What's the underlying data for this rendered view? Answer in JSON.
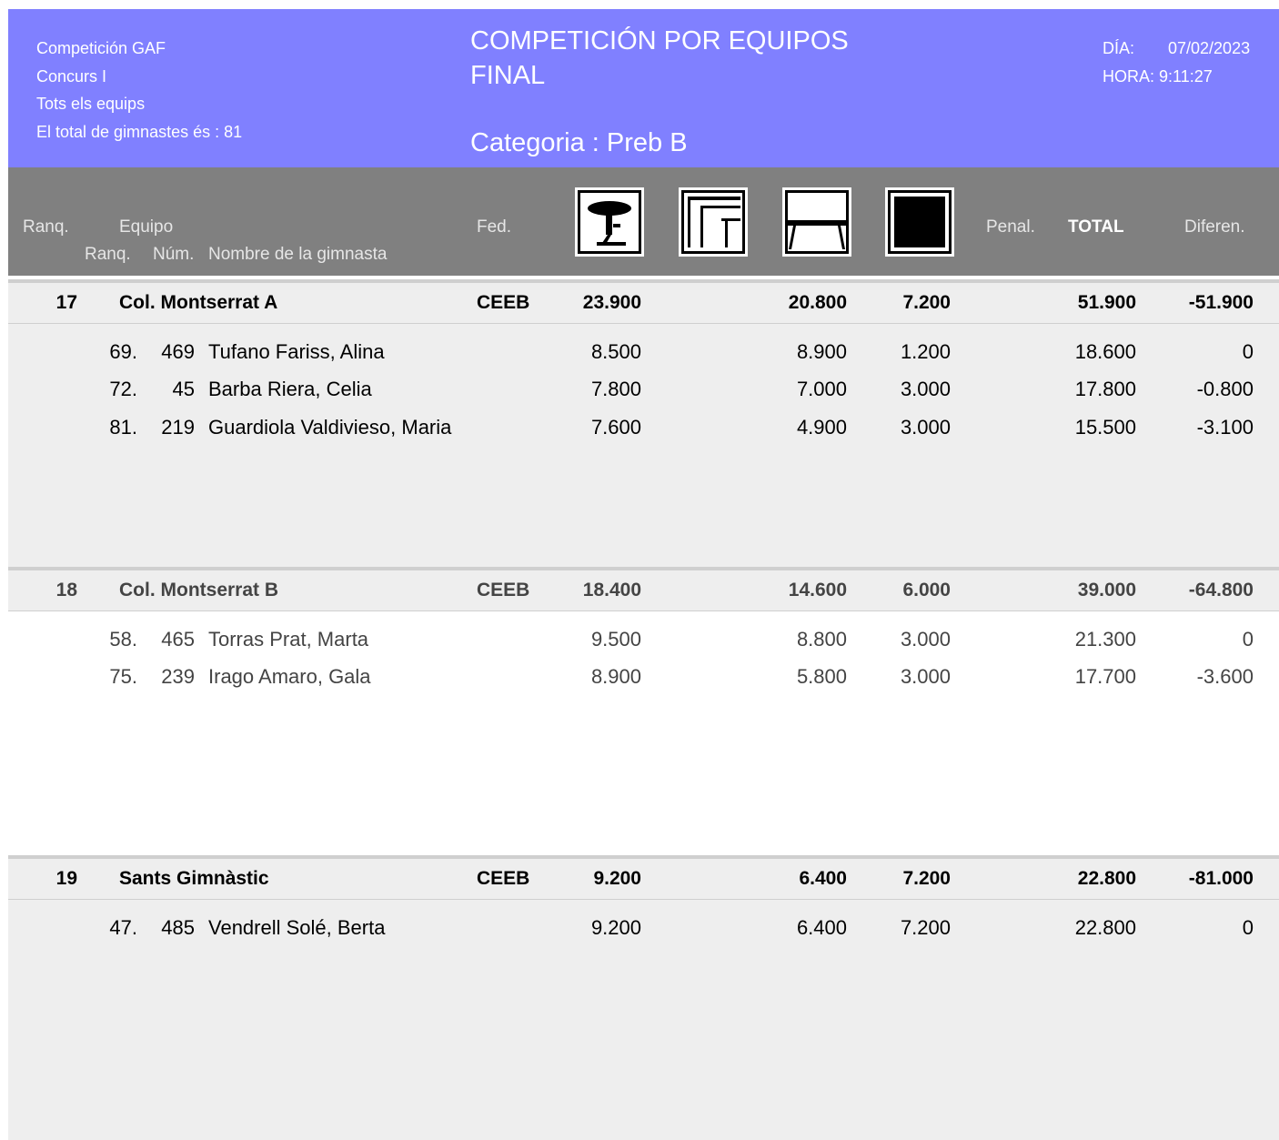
{
  "header": {
    "info_lines": [
      "Competición GAF",
      "Concurs I",
      "Tots els equips",
      "El total de gimnastes és : 81"
    ],
    "title_lines": [
      "COMPETICIÓN POR EQUIPOS",
      "FINAL"
    ],
    "category": "Categoria : Preb B",
    "date_label": "DÍA:",
    "date_value": "07/02/2023",
    "time_label": "HORA:",
    "time_value": "9:11:27"
  },
  "columns": {
    "rank": "Ranq.",
    "team": "Equipo",
    "sub_rank": "Ranq.",
    "num": "Núm.",
    "name": "Nombre de la gimnasta",
    "fed": "Fed.",
    "apparatus_icons": [
      "vault-icon",
      "uneven-bars-icon",
      "beam-icon",
      "floor-icon"
    ],
    "penal": "Penal.",
    "total": "TOTAL",
    "diff": "Diferen."
  },
  "colors": {
    "header_bg": "#8080ff",
    "column_header_bg": "#808080",
    "row_bg": "#eeeeee"
  },
  "teams": [
    {
      "rank": "17",
      "name": "Col. Montserrat A",
      "fed": "CEEB",
      "vault": "23.900",
      "bars": "",
      "beam": "20.800",
      "floor": "7.200",
      "penal": "",
      "total": "51.900",
      "diff": "-51.900",
      "gymnasts": [
        {
          "rank": "69.",
          "num": "469",
          "name": "Tufano Fariss, Alina",
          "vault": "8.500",
          "beam": "8.900",
          "floor": "1.200",
          "total": "18.600",
          "diff": "0"
        },
        {
          "rank": "72.",
          "num": "45",
          "name": "Barba Riera, Celia",
          "vault": "7.800",
          "beam": "7.000",
          "floor": "3.000",
          "total": "17.800",
          "diff": "-0.800"
        },
        {
          "rank": "81.",
          "num": "219",
          "name": "Guardiola Valdivieso, Maria",
          "vault": "7.600",
          "beam": "4.900",
          "floor": "3.000",
          "total": "15.500",
          "diff": "-3.100"
        }
      ]
    },
    {
      "rank": "18",
      "name": "Col. Montserrat B",
      "fed": "CEEB",
      "vault": "18.400",
      "bars": "",
      "beam": "14.600",
      "floor": "6.000",
      "penal": "",
      "total": "39.000",
      "diff": "-64.800",
      "gymnasts": [
        {
          "rank": "58.",
          "num": "465",
          "name": "Torras Prat, Marta",
          "vault": "9.500",
          "beam": "8.800",
          "floor": "3.000",
          "total": "21.300",
          "diff": "0"
        },
        {
          "rank": "75.",
          "num": "239",
          "name": "Irago Amaro, Gala",
          "vault": "8.900",
          "beam": "5.800",
          "floor": "3.000",
          "total": "17.700",
          "diff": "-3.600"
        }
      ]
    },
    {
      "rank": "19",
      "name": "Sants Gimnàstic",
      "fed": "CEEB",
      "vault": "9.200",
      "bars": "",
      "beam": "6.400",
      "floor": "7.200",
      "penal": "",
      "total": "22.800",
      "diff": "-81.000",
      "gymnasts": [
        {
          "rank": "47.",
          "num": "485",
          "name": "Vendrell Solé, Berta",
          "vault": "9.200",
          "beam": "6.400",
          "floor": "7.200",
          "total": "22.800",
          "diff": "0"
        }
      ]
    }
  ]
}
